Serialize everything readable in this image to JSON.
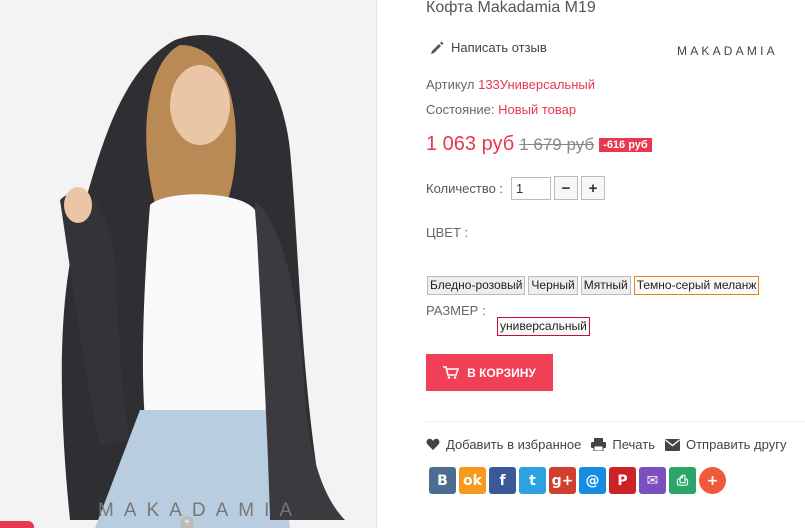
{
  "product": {
    "title": "Кофта Makadamia M19",
    "brand": "MAKADAMIA",
    "watermark": "MAKADAMIA",
    "review_link": "Написать отзыв",
    "sku_label": "Артикул",
    "sku_value": "133Универсальный",
    "condition_label": "Состояние:",
    "condition_value": "Новый товар",
    "price": "1 063 руб",
    "old_price": "1 679 руб",
    "discount": "-616 руб"
  },
  "quantity": {
    "label": "Количество :",
    "value": "1",
    "minus": "−",
    "plus": "+"
  },
  "color": {
    "label": "ЦВЕТ :",
    "options": [
      "Бледно-розовый",
      "Черный",
      "Мятный",
      "Темно-серый меланж"
    ],
    "selected": "Темно-серый меланж"
  },
  "size": {
    "label": "РАЗМЕР :",
    "options": [
      "универсальный"
    ],
    "selected": "универсальный"
  },
  "cart_button": "В КОРЗИНУ",
  "actions": {
    "favorite": "Добавить в избранное",
    "print": "Печать",
    "send": "Отправить другу"
  },
  "social": [
    {
      "icon": "vk-icon",
      "glyph": "В",
      "color": "#4c6c91"
    },
    {
      "icon": "odnoklassniki-icon",
      "glyph": "ok",
      "color": "#f59a1f"
    },
    {
      "icon": "facebook-icon",
      "glyph": "f",
      "color": "#3b5998"
    },
    {
      "icon": "twitter-icon",
      "glyph": "t",
      "color": "#2ca3e0"
    },
    {
      "icon": "google-plus-icon",
      "glyph": "g+",
      "color": "#d1402f"
    },
    {
      "icon": "mail-at-icon",
      "glyph": "@",
      "color": "#168de2"
    },
    {
      "icon": "pinterest-icon",
      "glyph": "P",
      "color": "#cb2127"
    },
    {
      "icon": "email-icon",
      "glyph": "✉",
      "color": "#7b4fbd"
    },
    {
      "icon": "print-icon",
      "glyph": "⎙",
      "color": "#2ba56a"
    },
    {
      "icon": "more-icon",
      "glyph": "+",
      "color": "#ee5a3a"
    }
  ],
  "colors": {
    "accent": "#e8384f",
    "button": "#f13f56"
  }
}
